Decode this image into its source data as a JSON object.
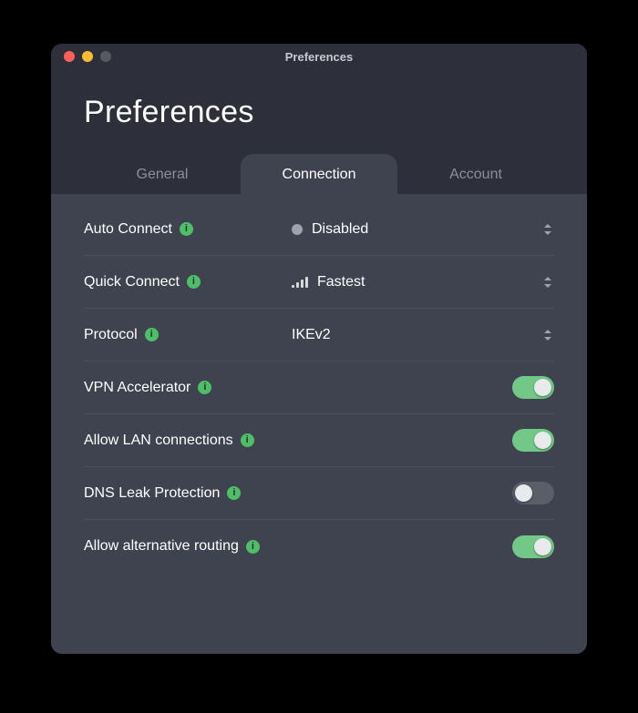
{
  "window": {
    "title": "Preferences"
  },
  "header": {
    "title": "Preferences"
  },
  "tabs": {
    "items": [
      {
        "label": "General"
      },
      {
        "label": "Connection"
      },
      {
        "label": "Account"
      }
    ],
    "active_index": 1
  },
  "settings": {
    "auto_connect": {
      "label": "Auto Connect",
      "value": "Disabled",
      "indicator": "dot"
    },
    "quick_connect": {
      "label": "Quick Connect",
      "value": "Fastest",
      "indicator": "signal"
    },
    "protocol": {
      "label": "Protocol",
      "value": "IKEv2",
      "indicator": "none"
    },
    "vpn_accel": {
      "label": "VPN Accelerator",
      "on": true
    },
    "allow_lan": {
      "label": "Allow LAN connections",
      "on": true
    },
    "dns_leak": {
      "label": "DNS Leak Protection",
      "on": false
    },
    "alt_routing": {
      "label": "Allow alternative routing",
      "on": true
    }
  }
}
